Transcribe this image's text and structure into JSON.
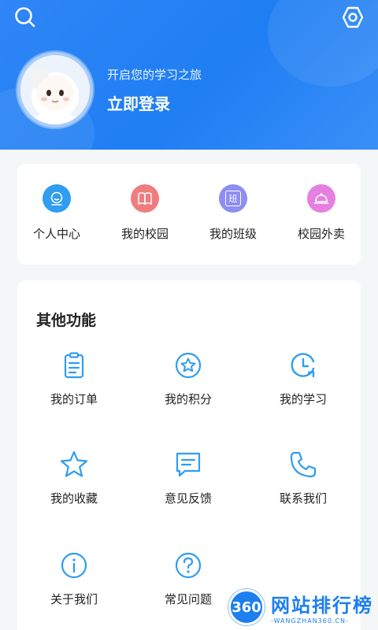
{
  "header": {
    "greeting": "开启您的学习之旅",
    "login_label": "立即登录"
  },
  "quick_menu": [
    {
      "label": "个人中心",
      "icon": "user-smile-icon",
      "color": "#2f9df0"
    },
    {
      "label": "我的校园",
      "icon": "book-icon",
      "color": "#f07d7d"
    },
    {
      "label": "我的班级",
      "icon": "class-badge-icon",
      "color": "#8d8df2"
    },
    {
      "label": "校园外卖",
      "icon": "food-cloche-icon",
      "color": "#e57fe0"
    }
  ],
  "quick_menu_badge": "班",
  "other_functions": {
    "title": "其他功能",
    "items": [
      {
        "label": "我的订单",
        "icon": "clipboard-icon"
      },
      {
        "label": "我的积分",
        "icon": "star-circle-icon"
      },
      {
        "label": "我的学习",
        "icon": "clock-icon"
      },
      {
        "label": "我的收藏",
        "icon": "star-icon"
      },
      {
        "label": "意见反馈",
        "icon": "message-icon"
      },
      {
        "label": "联系我们",
        "icon": "phone-icon"
      },
      {
        "label": "关于我们",
        "icon": "info-icon"
      },
      {
        "label": "常见问题",
        "icon": "question-icon"
      }
    ]
  },
  "watermark": {
    "badge": "360",
    "main": "网站排行榜",
    "sub": "-WANGZHAN360.CN-"
  },
  "colors": {
    "header_blue": "#2f86f6",
    "icon_blue": "#2f9df0"
  }
}
